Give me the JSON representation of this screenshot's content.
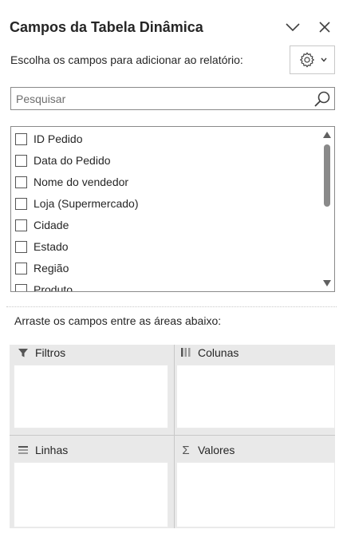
{
  "panel": {
    "title": "Campos da Tabela Dinâmica",
    "subtitle": "Escolha os campos para adicionar ao relatório:"
  },
  "search": {
    "placeholder": "Pesquisar",
    "value": ""
  },
  "fields": [
    {
      "label": "ID Pedido",
      "checked": false
    },
    {
      "label": "Data do Pedido",
      "checked": false
    },
    {
      "label": "Nome do vendedor",
      "checked": false
    },
    {
      "label": "Loja (Supermercado)",
      "checked": false
    },
    {
      "label": "Cidade",
      "checked": false
    },
    {
      "label": "Estado",
      "checked": false
    },
    {
      "label": "Região",
      "checked": false
    },
    {
      "label": "Produto",
      "checked": false
    }
  ],
  "areas": {
    "hint": "Arraste os campos entre as áreas abaixo:",
    "filters": {
      "label": "Filtros",
      "icon": "filter-icon"
    },
    "columns": {
      "label": "Colunas",
      "icon": "columns-icon"
    },
    "rows": {
      "label": "Linhas",
      "icon": "rows-icon"
    },
    "values": {
      "label": "Valores",
      "icon": "sigma-icon",
      "glyph": "Σ"
    }
  },
  "colors": {
    "text": "#262626",
    "border": "#8a8a8a",
    "area_background": "#e9e9e9"
  }
}
